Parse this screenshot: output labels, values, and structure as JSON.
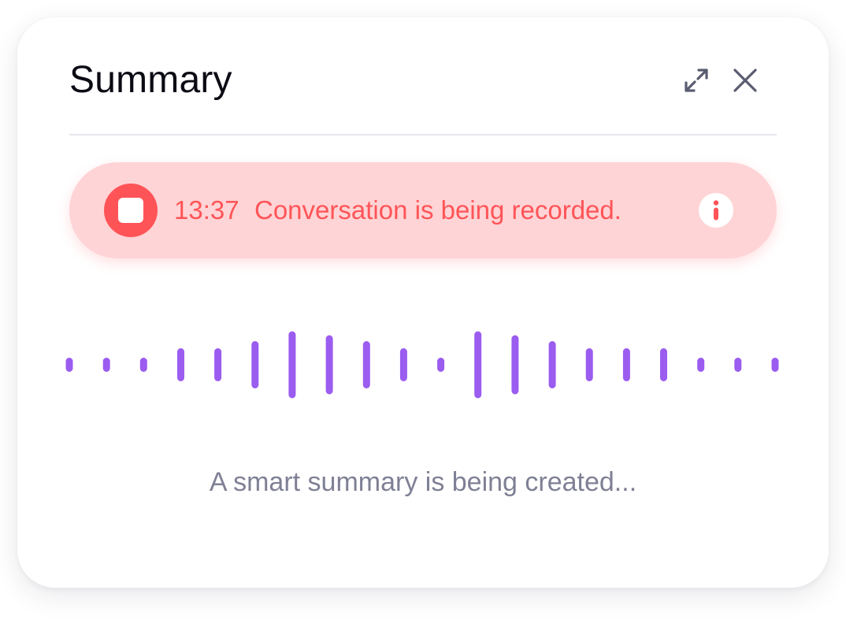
{
  "panel": {
    "title": "Summary",
    "expand_icon": "expand-icon",
    "close_icon": "close-icon"
  },
  "recording": {
    "timer": "13:37",
    "message": "Conversation is being recorded.",
    "stop_icon": "stop-icon",
    "info_icon": "info-icon"
  },
  "waveform": {
    "color": "#9b5cf0",
    "levels": [
      0.1,
      0.1,
      0.1,
      0.42,
      0.42,
      0.6,
      0.85,
      0.75,
      0.6,
      0.42,
      0.1,
      0.85,
      0.75,
      0.6,
      0.42,
      0.42,
      0.42,
      0.1,
      0.1,
      0.1
    ]
  },
  "status": {
    "text": "A smart summary is being created..."
  },
  "colors": {
    "accent": "#ff5457",
    "recording_background": "#ffd4d6",
    "waveform": "#9b5cf0",
    "status_text": "#7f8095"
  }
}
